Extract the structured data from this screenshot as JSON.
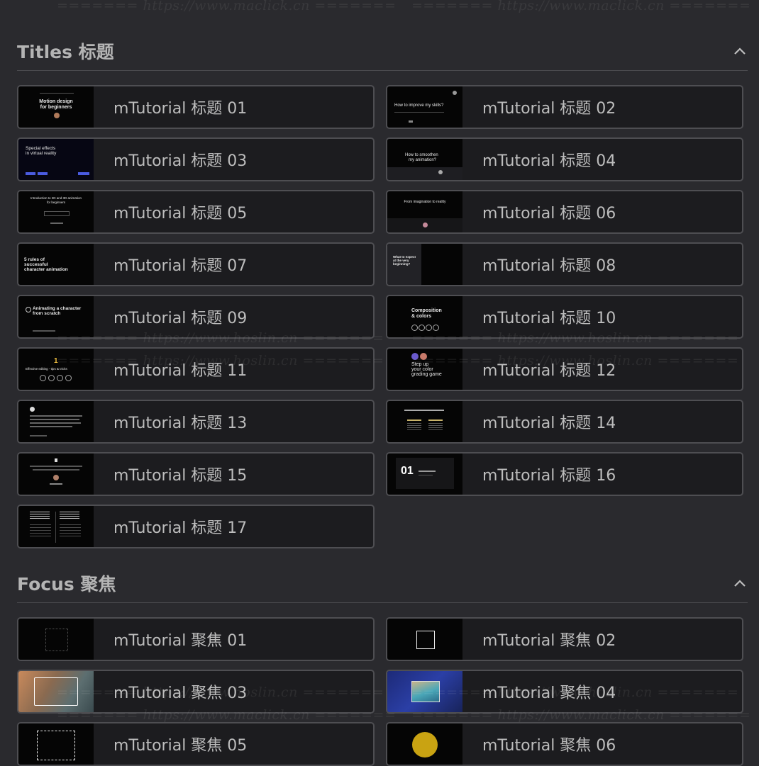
{
  "watermarks": {
    "maclick": "======= https://www.maclick.cn =======",
    "hoslin": "======= https://www.hoslin.cn ======="
  },
  "sections": [
    {
      "title": "Titles 标题",
      "items": [
        {
          "label": "mTutorial 标题 01",
          "thumb": [
            "Motion design",
            "for beginners"
          ]
        },
        {
          "label": "mTutorial 标题 02",
          "thumb": [
            "How to improve my skills?"
          ]
        },
        {
          "label": "mTutorial 标题 03",
          "thumb": [
            "Special effects",
            "in virtual reality"
          ]
        },
        {
          "label": "mTutorial 标题 04",
          "thumb": [
            "How to smoothen",
            "my animation?"
          ]
        },
        {
          "label": "mTutorial 标题 05",
          "thumb": [
            "Introduction to 2D and 3D animation",
            "for beginners"
          ]
        },
        {
          "label": "mTutorial 标题 06",
          "thumb": [
            "From imagination to reality"
          ]
        },
        {
          "label": "mTutorial 标题 07",
          "thumb": [
            "5 rules of",
            "successful",
            "character animation"
          ]
        },
        {
          "label": "mTutorial 标题 08",
          "thumb": [
            "What to expect",
            "at the very",
            "beginning?"
          ]
        },
        {
          "label": "mTutorial 标题 09",
          "thumb": [
            "Animating a character",
            "from scratch"
          ]
        },
        {
          "label": "mTutorial 标题 10",
          "thumb": [
            "Composition",
            "& colors"
          ]
        },
        {
          "label": "mTutorial 标题 11",
          "thumb": [
            "1",
            "Effective editing - tips & tricks"
          ]
        },
        {
          "label": "mTutorial 标题 12",
          "thumb": [
            "Step up",
            "your color",
            "grading game"
          ]
        },
        {
          "label": "mTutorial 标题 13",
          "thumb": []
        },
        {
          "label": "mTutorial 标题 14",
          "thumb": []
        },
        {
          "label": "mTutorial 标题 15",
          "thumb": []
        },
        {
          "label": "mTutorial 标题 16",
          "thumb": [
            "01"
          ]
        },
        {
          "label": "mTutorial 标题 17",
          "thumb": []
        }
      ]
    },
    {
      "title": "Focus 聚焦",
      "items": [
        {
          "label": "mTutorial 聚焦 01"
        },
        {
          "label": "mTutorial 聚焦 02"
        },
        {
          "label": "mTutorial 聚焦 03"
        },
        {
          "label": "mTutorial 聚焦 04"
        },
        {
          "label": "mTutorial 聚焦 05"
        },
        {
          "label": "mTutorial 聚焦 06"
        }
      ]
    }
  ],
  "icons": {
    "collapse": "chevron-up-icon"
  }
}
